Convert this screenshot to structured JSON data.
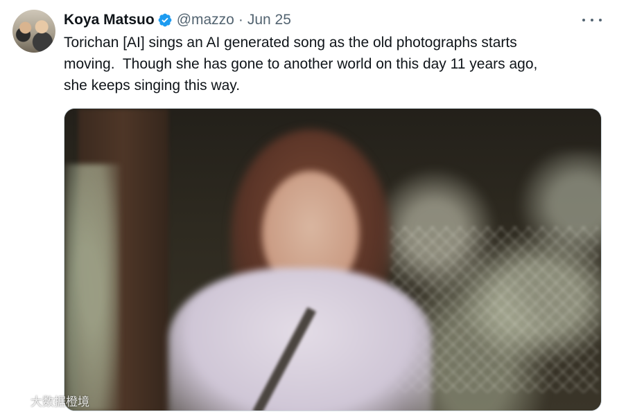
{
  "tweet": {
    "author": {
      "display_name": "Koya Matsuo",
      "handle": "@mazzo",
      "verified_icon": "verified-badge-icon"
    },
    "separator": "·",
    "date": "Jun 25",
    "more_icon": "more-options-icon",
    "text_lines": [
      "Torichan [AI] sings an AI generated song as the old photographs starts",
      "moving.  Though she has gone to another world on this day 11 years ago,",
      "she keeps singing this way."
    ],
    "media": {
      "kind": "video"
    }
  },
  "watermark": {
    "logo_icon": "watermark-logo-icon",
    "text": "大数据橙境"
  },
  "colors": {
    "text_primary": "#0f1419",
    "text_secondary": "#536471",
    "verified_blue": "#1d9bf0",
    "border": "#cfd9de"
  }
}
